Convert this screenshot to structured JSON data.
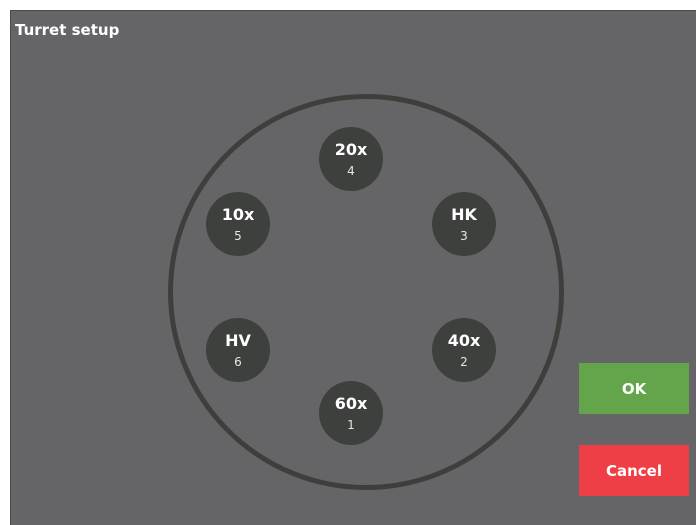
{
  "window": {
    "title": "Turret setup"
  },
  "turret": {
    "slots": [
      {
        "name": "20x",
        "position": "4"
      },
      {
        "name": "10x",
        "position": "5"
      },
      {
        "name": "HK",
        "position": "3"
      },
      {
        "name": "HV",
        "position": "6"
      },
      {
        "name": "40x",
        "position": "2"
      },
      {
        "name": "60x",
        "position": "1"
      }
    ]
  },
  "buttons": {
    "ok": "OK",
    "cancel": "Cancel"
  },
  "colors": {
    "background": "#656466",
    "slot": "#3e403e",
    "ring": "#3d3f3c",
    "ok": "#64a54b",
    "cancel": "#ef3f46"
  }
}
